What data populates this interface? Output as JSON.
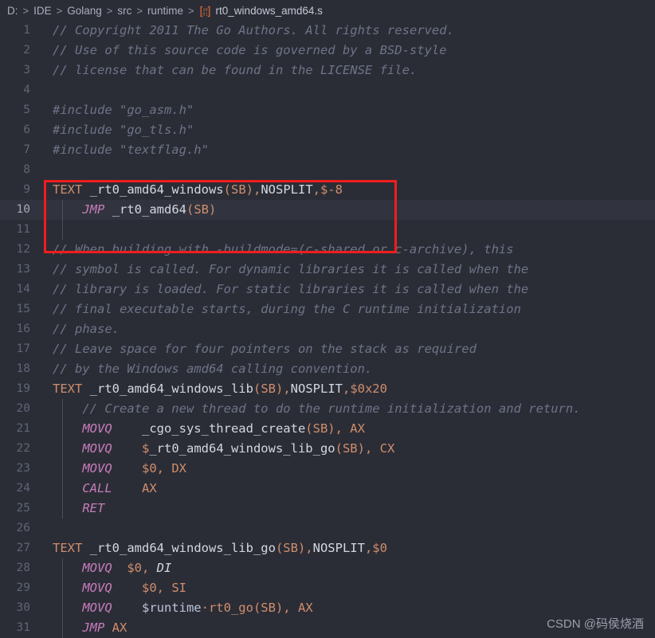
{
  "breadcrumb": {
    "items": [
      "D:",
      "IDE",
      "Golang",
      "src",
      "runtime"
    ],
    "separator": ">",
    "file_icon": "binary-file-icon",
    "file_icon_glyph_top": "10",
    "file_icon_glyph_bottom": "01",
    "file_name": "rt0_windows_amd64.s"
  },
  "watermark": "CSDN @码侯烧酒",
  "colors": {
    "editor_background": "#2b2d36",
    "caret_line_background": "#31343e",
    "annotation_rect": "#f01d1d",
    "comment": "#6d7488",
    "keyword": "#cf8e6d",
    "identifier": "#d4d7e0",
    "instruction": "#c77dbb",
    "gutter_text": "#5e6576",
    "gutter_text_active": "#a4aabb",
    "indent_guide": "#4a4f5e"
  },
  "editor": {
    "caret_line": 10,
    "lines": [
      {
        "n": 1,
        "tokens": [
          {
            "t": "com",
            "v": "// Copyright 2011 The Go Authors. All rights reserved."
          }
        ]
      },
      {
        "n": 2,
        "tokens": [
          {
            "t": "com",
            "v": "// Use of this source code is governed by a BSD-style"
          }
        ]
      },
      {
        "n": 3,
        "tokens": [
          {
            "t": "com",
            "v": "// license that can be found in the LICENSE file."
          }
        ]
      },
      {
        "n": 4,
        "tokens": []
      },
      {
        "n": 5,
        "tokens": [
          {
            "t": "com",
            "v": "#include \"go_asm.h\""
          }
        ]
      },
      {
        "n": 6,
        "tokens": [
          {
            "t": "com",
            "v": "#include \"go_tls.h\""
          }
        ]
      },
      {
        "n": 7,
        "tokens": [
          {
            "t": "com",
            "v": "#include \"textflag.h\""
          }
        ]
      },
      {
        "n": 8,
        "tokens": []
      },
      {
        "n": 9,
        "tokens": [
          {
            "t": "kw",
            "v": "TEXT "
          },
          {
            "t": "id",
            "v": "_rt0_amd64_windows"
          },
          {
            "t": "punc",
            "v": "(SB),"
          },
          {
            "t": "plain",
            "v": "NOSPLIT"
          },
          {
            "t": "punc",
            "v": ",$-8"
          }
        ]
      },
      {
        "n": 10,
        "tokens": [
          {
            "t": "plain",
            "v": "    "
          },
          {
            "t": "instr",
            "v": "JMP"
          },
          {
            "t": "plain",
            "v": " "
          },
          {
            "t": "id",
            "v": "_rt0_amd64"
          },
          {
            "t": "punc",
            "v": "(SB)"
          }
        ]
      },
      {
        "n": 11,
        "tokens": []
      },
      {
        "n": 12,
        "tokens": [
          {
            "t": "com",
            "v": "// When building with -buildmode=(c-shared or c-archive), this"
          }
        ]
      },
      {
        "n": 13,
        "tokens": [
          {
            "t": "com",
            "v": "// symbol is called. For dynamic libraries it is called when the"
          }
        ]
      },
      {
        "n": 14,
        "tokens": [
          {
            "t": "com",
            "v": "// library is loaded. For static libraries it is called when the"
          }
        ]
      },
      {
        "n": 15,
        "tokens": [
          {
            "t": "com",
            "v": "// final executable starts, during the C runtime initialization"
          }
        ]
      },
      {
        "n": 16,
        "tokens": [
          {
            "t": "com",
            "v": "// phase."
          }
        ]
      },
      {
        "n": 17,
        "tokens": [
          {
            "t": "com",
            "v": "// Leave space for four pointers on the stack as required"
          }
        ]
      },
      {
        "n": 18,
        "tokens": [
          {
            "t": "com",
            "v": "// by the Windows amd64 calling convention."
          }
        ]
      },
      {
        "n": 19,
        "tokens": [
          {
            "t": "kw",
            "v": "TEXT "
          },
          {
            "t": "id",
            "v": "_rt0_amd64_windows_lib"
          },
          {
            "t": "punc",
            "v": "(SB),"
          },
          {
            "t": "plain",
            "v": "NOSPLIT"
          },
          {
            "t": "punc",
            "v": ",$0x20"
          }
        ]
      },
      {
        "n": 20,
        "tokens": [
          {
            "t": "com",
            "v": "    // Create a new thread to do the runtime initialization and return."
          }
        ]
      },
      {
        "n": 21,
        "tokens": [
          {
            "t": "plain",
            "v": "    "
          },
          {
            "t": "instr",
            "v": "MOVQ"
          },
          {
            "t": "plain",
            "v": "    "
          },
          {
            "t": "id",
            "v": "_cgo_sys_thread_create"
          },
          {
            "t": "punc",
            "v": "(SB), "
          },
          {
            "t": "reg",
            "v": "AX"
          }
        ]
      },
      {
        "n": 22,
        "tokens": [
          {
            "t": "plain",
            "v": "    "
          },
          {
            "t": "instr",
            "v": "MOVQ"
          },
          {
            "t": "plain",
            "v": "    "
          },
          {
            "t": "punc",
            "v": "$"
          },
          {
            "t": "id",
            "v": "_rt0_amd64_windows_lib_go"
          },
          {
            "t": "punc",
            "v": "(SB), "
          },
          {
            "t": "reg",
            "v": "CX"
          }
        ]
      },
      {
        "n": 23,
        "tokens": [
          {
            "t": "plain",
            "v": "    "
          },
          {
            "t": "instr",
            "v": "MOVQ"
          },
          {
            "t": "plain",
            "v": "    "
          },
          {
            "t": "punc",
            "v": "$0, "
          },
          {
            "t": "reg",
            "v": "DX"
          }
        ]
      },
      {
        "n": 24,
        "tokens": [
          {
            "t": "plain",
            "v": "    "
          },
          {
            "t": "instr",
            "v": "CALL"
          },
          {
            "t": "plain",
            "v": "    "
          },
          {
            "t": "reg",
            "v": "AX"
          }
        ]
      },
      {
        "n": 25,
        "tokens": [
          {
            "t": "plain",
            "v": "    "
          },
          {
            "t": "instr",
            "v": "RET"
          }
        ]
      },
      {
        "n": 26,
        "tokens": []
      },
      {
        "n": 27,
        "tokens": [
          {
            "t": "kw",
            "v": "TEXT "
          },
          {
            "t": "id",
            "v": "_rt0_amd64_windows_lib_go"
          },
          {
            "t": "punc",
            "v": "(SB),"
          },
          {
            "t": "plain",
            "v": "NOSPLIT"
          },
          {
            "t": "punc",
            "v": ",$0"
          }
        ]
      },
      {
        "n": 28,
        "tokens": [
          {
            "t": "plain",
            "v": "    "
          },
          {
            "t": "instr",
            "v": "MOVQ"
          },
          {
            "t": "plain",
            "v": "  "
          },
          {
            "t": "punc",
            "v": "$0, "
          },
          {
            "t": "regi",
            "v": "DI"
          }
        ]
      },
      {
        "n": 29,
        "tokens": [
          {
            "t": "plain",
            "v": "    "
          },
          {
            "t": "instr",
            "v": "MOVQ"
          },
          {
            "t": "plain",
            "v": "    "
          },
          {
            "t": "punc",
            "v": "$0, "
          },
          {
            "t": "reg",
            "v": "SI"
          }
        ]
      },
      {
        "n": 30,
        "tokens": [
          {
            "t": "plain",
            "v": "    "
          },
          {
            "t": "instr",
            "v": "MOVQ"
          },
          {
            "t": "plain",
            "v": "    "
          },
          {
            "t": "sym",
            "v": "$runtime"
          },
          {
            "t": "punc",
            "v": "·rt0_go(SB), "
          },
          {
            "t": "reg",
            "v": "AX"
          }
        ]
      },
      {
        "n": 31,
        "tokens": [
          {
            "t": "plain",
            "v": "    "
          },
          {
            "t": "instr",
            "v": "JMP"
          },
          {
            "t": "plain",
            "v": " "
          },
          {
            "t": "reg",
            "v": "AX"
          }
        ]
      }
    ]
  }
}
